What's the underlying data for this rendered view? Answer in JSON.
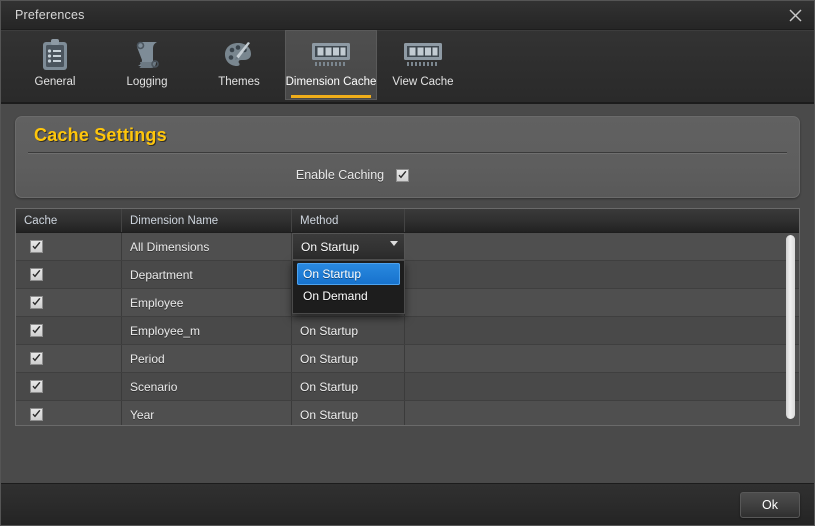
{
  "window": {
    "title": "Preferences",
    "close_icon": "close-icon"
  },
  "tabs": [
    {
      "label": "General",
      "icon": "clipboard-icon",
      "active": false
    },
    {
      "label": "Logging",
      "icon": "scroll-icon",
      "active": false
    },
    {
      "label": "Themes",
      "icon": "palette-icon",
      "active": false
    },
    {
      "label": "Dimension Cache",
      "icon": "memory-icon",
      "active": true
    },
    {
      "label": "View Cache",
      "icon": "memory-icon",
      "active": false
    }
  ],
  "cache_settings": {
    "title": "Cache Settings",
    "enable_caching_label": "Enable Caching",
    "enable_caching_checked": "checked"
  },
  "table": {
    "headers": [
      "Cache",
      "Dimension Name",
      "Method",
      ""
    ],
    "rows": [
      {
        "cache": "checked",
        "name": "All Dimensions",
        "method": "On Startup"
      },
      {
        "cache": "checked",
        "name": "Department",
        "method": "On Startup"
      },
      {
        "cache": "checked",
        "name": "Employee",
        "method": "On Startup"
      },
      {
        "cache": "checked",
        "name": "Employee_m",
        "method": "On Startup"
      },
      {
        "cache": "checked",
        "name": "Period",
        "method": "On Startup"
      },
      {
        "cache": "checked",
        "name": "Scenario",
        "method": "On Startup"
      },
      {
        "cache": "checked",
        "name": "Year",
        "method": "On Startup"
      }
    ]
  },
  "method_dropdown": {
    "open": "true",
    "selected": "On Startup",
    "options": [
      "On Startup",
      "On Demand"
    ]
  },
  "footer": {
    "ok_label": "Ok"
  },
  "colors": {
    "accent_gold": "#ffc60b",
    "tab_underline": "#f0ae1a",
    "selection_blue": "#1671cc",
    "panel_gray": "#5e5e5e",
    "window_gray": "#4a4a4a"
  }
}
